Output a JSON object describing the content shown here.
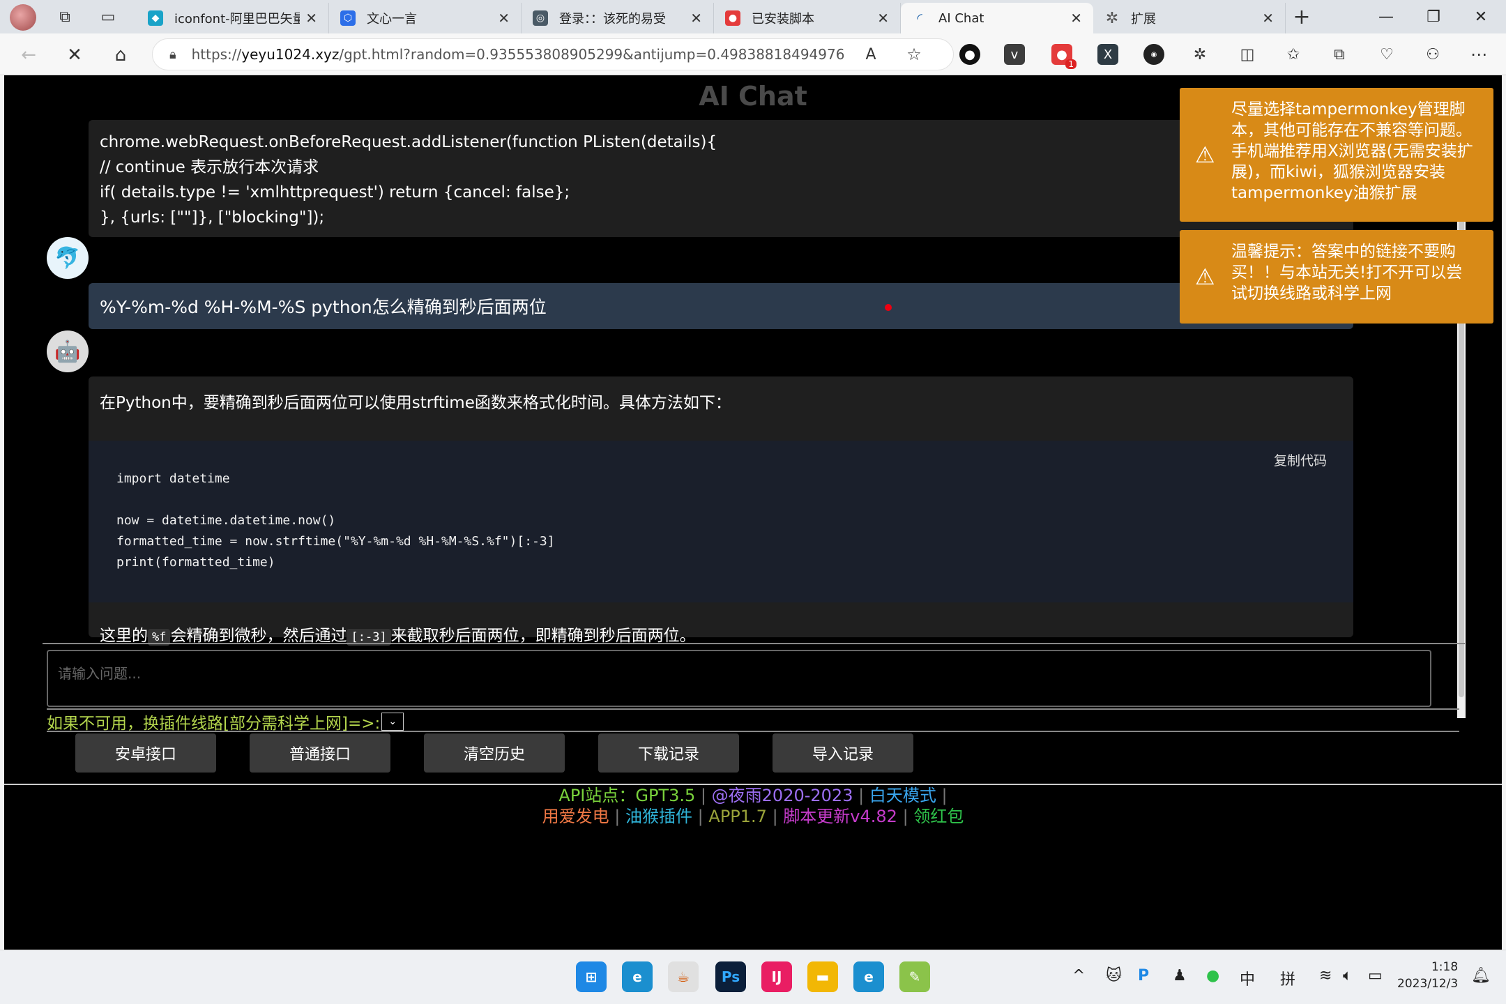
{
  "browser": {
    "tabs": [
      {
        "label": "iconfont-阿里巴巴矢量",
        "close": "✕",
        "icon": "iconfont-icon",
        "color": "#1aa3c8"
      },
      {
        "label": "文心一言",
        "close": "✕",
        "icon": "wenxin-icon",
        "color": "#2c6ee8"
      },
      {
        "label": "登录：：该死的易受",
        "close": "✕",
        "icon": "login-icon",
        "color": "#4a5a66"
      },
      {
        "label": "已安装脚本",
        "close": "✕",
        "icon": "tampermonkey-icon",
        "color": "#e43b3b"
      },
      {
        "label": "AI Chat",
        "close": "✕",
        "icon": "loading-icon",
        "color": "#2b6cb0"
      },
      {
        "label": "扩展",
        "close": "✕",
        "icon": "extensions-icon",
        "color": "#555555"
      }
    ],
    "new_tab": "+",
    "url_prefix": "https://",
    "url_host": "yeyu1024.xyz",
    "url_path": "/gpt.html?random=0.935553808905299&antijump=0.49838818494976",
    "ext_badge": "1"
  },
  "page": {
    "title": "AI Chat",
    "code_message": [
      "chrome.webRequest.onBeforeRequest.addListener(function PListen(details){",
      "// continue 表示放行本次请求",
      "if( details.type != 'xmlhttprequest') return {cancel: false};",
      "}, {urls: [\"\"]}, [\"blocking\"]);"
    ],
    "user_message": "%Y-%m-%d %H-%M-%S python怎么精确到秒后面两位",
    "answer": {
      "intro": "在Python中，要精确到秒后面两位可以使用strftime函数来格式化时间。具体方法如下：",
      "copy_label": "复制代码",
      "code": "import datetime\n\nnow = datetime.datetime.now()\nformatted_time = now.strftime(\"%Y-%m-%d %H-%M-%S.%f\")[:-3]\nprint(formatted_time)",
      "outro_1": "这里的",
      "outro_code_1": "%f",
      "outro_2": "会精确到微秒，然后通过",
      "outro_code_2": "[:-3]",
      "outro_3": "来截取秒后面两位，即精确到秒后面两位。"
    },
    "input_placeholder": "请输入问题...",
    "route_label": "如果不可用，换插件线路[部分需科学上网]=>:",
    "buttons": [
      "安卓接口",
      "普通接口",
      "清空历史",
      "下载记录",
      "导入记录"
    ],
    "footer": {
      "api": "API站点：GPT3.5",
      "author": "@夜雨2020-2023",
      "day_mode": "白天模式",
      "power": "用爱发电",
      "plugin": "油猴插件",
      "app": "APP1.7",
      "update": "脚本更新v4.82",
      "redpacket": "领红包"
    },
    "toasts": [
      "尽量选择tampermonkey管理脚本，其他可能存在不兼容等问题。手机端推荐用X浏览器(无需安装扩展)，而kiwi，狐猴浏览器安装tampermonkey油猴扩展",
      "温馨提示：答案中的链接不要购买！！与本站无关!打不开可以尝试切换线路或科学上网"
    ]
  },
  "taskbar": {
    "ime_1": "中",
    "ime_2": "拼",
    "time": "1:18",
    "date": "2023/12/3"
  }
}
